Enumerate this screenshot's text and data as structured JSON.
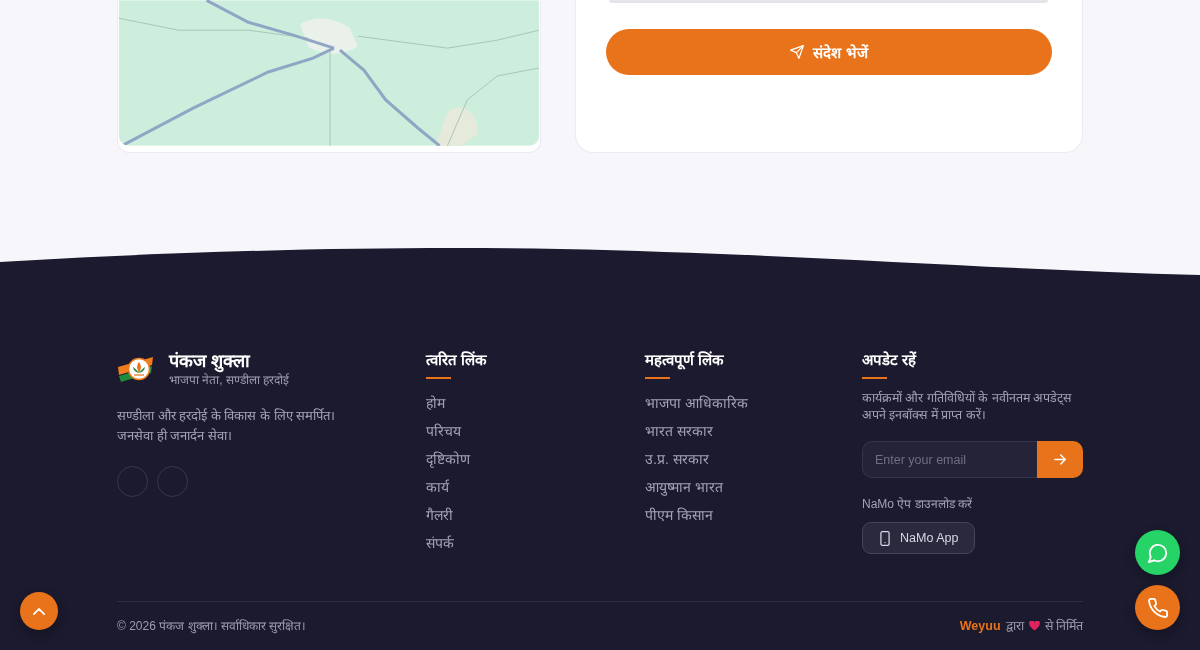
{
  "contact_form": {
    "submit_button": {
      "label": "संदेश भेजें"
    }
  },
  "footer": {
    "brand": {
      "name": "पंकज शुक्ला",
      "tagline": "भाजपा नेता, सण्डीला हरदोई",
      "description": "सण्डीला और हरदोई के विकास के लिए समर्पित।\nजनसेवा ही जनार्दन सेवा।"
    },
    "quick_links": {
      "title": "त्वरित लिंक",
      "items": [
        "होम",
        "परिचय",
        "दृष्टिकोण",
        "कार्य",
        "गैलरी",
        "संपर्क"
      ]
    },
    "important_links": {
      "title": "महत्वपूर्ण लिंक",
      "items": [
        "भाजपा आधिकारिक",
        "भारत सरकार",
        "उ.प्र. सरकार",
        "आयुष्मान भारत",
        "पीएम किसान"
      ]
    },
    "newsletter": {
      "title": "अपडेट रहें",
      "description": "कार्यक्रमों और गतिविधियों के नवीनतम अपडेट्स अपने इनबॉक्स में प्राप्त करें।",
      "email_field": {
        "placeholder": "Enter your email"
      },
      "app_label": "NaMo ऐप डाउनलोड करें",
      "app_button": {
        "label": "NaMo App"
      }
    },
    "bottom_bar": {
      "copyright": "© 2026 पंकज शुक्ला। सर्वाधिकार सुरक्षित।",
      "credit": {
        "link": "Weyuu",
        "before_heart": "द्वारा",
        "after_heart": "से निर्मित"
      }
    }
  }
}
